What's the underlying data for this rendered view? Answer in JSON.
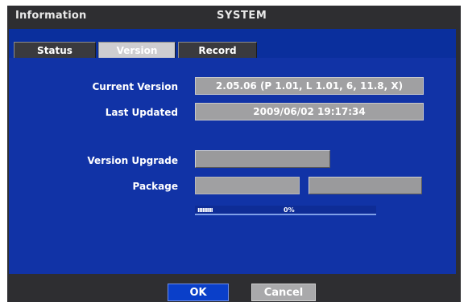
{
  "window": {
    "title_left": "Information",
    "title_center": "SYSTEM"
  },
  "tabs": [
    {
      "label": "Status",
      "selected": false
    },
    {
      "label": "Version",
      "selected": true
    },
    {
      "label": "Record",
      "selected": false
    }
  ],
  "version": {
    "current_version_label": "Current Version",
    "current_version_value": "2.05.06 (P 1.01,  L 1.01,  6,  11.8, X)",
    "last_updated_label": "Last Updated",
    "last_updated_value": "2009/06/02  19:17:34",
    "upgrade_label": "Version Upgrade",
    "upgrade_button": "",
    "package_label": "Package",
    "package_value": "",
    "package_button": ""
  },
  "progress": {
    "ticks": "ııııııııı",
    "percent_text": "0%",
    "percent": 0
  },
  "footer": {
    "ok_label": "OK",
    "cancel_label": "Cancel"
  },
  "colors": {
    "panel": "#1133a6",
    "frame": "#2e2e31",
    "ok_button": "#0a3fc9",
    "field": "#a0a0a2"
  }
}
